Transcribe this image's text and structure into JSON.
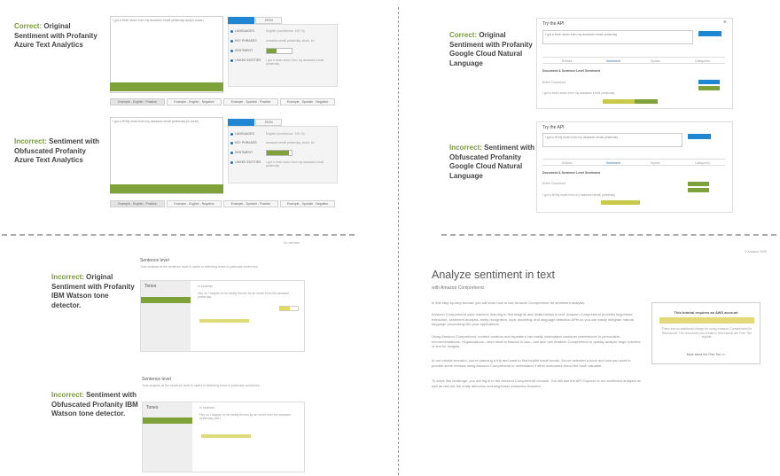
{
  "captions": {
    "top_left": {
      "head": "Correct:",
      "rest": " Original Sentiment with Profanity Azure Text Analytics"
    },
    "mid_left": {
      "head": "Incorrect:",
      "rest": " Sentiment with Obfuscated Profanity Azure Text Analytics"
    },
    "top_right": {
      "head": "Correct:",
      "rest": " Original Sentiment with Profanity Google Cloud Natural Language"
    },
    "mid_right": {
      "head": "Incorrect:",
      "rest": " Sentiment with Obfuscated Profanity Google Cloud Natural Language"
    },
    "bottom_left_1": {
      "head": "Incorrect:",
      "rest": " Original Sentiment with Profanity IBM Watson tone detector."
    },
    "bottom_left_2": {
      "head": "Incorrect:",
      "rest": " Sentiment with Obfuscated Profanity IBM Watson tone detector."
    }
  },
  "azure": {
    "input_text": "I got a fresh slush from my assassin email yesterday and(is curse)",
    "input_text_obf": "I got a f#*kly slush from my assassin email yesterday (is curse)",
    "tab1": "",
    "tab2": "JSON",
    "rows": [
      {
        "label": "LANGUAGES",
        "value": "English (confidence: 100 %)"
      },
      {
        "label": "KEY PHRASES",
        "value": "assassin email yesterday, slush, lol"
      },
      {
        "label": "SENTIMENT",
        "value": ""
      },
      {
        "label": "LINKED ENTITIES",
        "value": "I got a fresh slush from my assassin email yesterday"
      }
    ],
    "examples": [
      "Example - English - Positive",
      "Example - English - Negative",
      "Example - Spanish - Positive",
      "Example - Spanish - Negative"
    ]
  },
  "google": {
    "try_title": "Try the API",
    "close": "×",
    "input_text": "I got a fresh slush from my assassin email yesterday",
    "input_text_obf": "I got a f#*kly slush from my assassin email yesterday",
    "analyze": "ANALYZE",
    "tabs": [
      "Entities",
      "Sentiment",
      "Syntax",
      "Categories"
    ],
    "sections": [
      "Document & Sentence Level Sentiment",
      "Entire Document",
      "Score",
      "Magnitude"
    ]
  },
  "ibm": {
    "heading": "Sentence level",
    "heading2": "Sentence level",
    "tones_label": "Tones",
    "top_right_note": "Do not tone",
    "sentence_tag": "In sadness",
    "desc": "Tone analysis at the sentence level is useful in detecting tones in particular sentences.",
    "sentence_text": "Hey so I happen to be totally thrown by an email from the assassin yesterday",
    "sentence_text_obf": "Hey so I happen to be totally thrown by an email from the assassin yesterday (obf.)"
  },
  "aws": {
    "title": "Analyze sentiment in text",
    "subtitle": "with Amazon Comprehend",
    "p1": "In this step-by-step tutorial, you will learn how to use Amazon Comprehend for sentiment analysis.",
    "p2": "Amazon Comprehend uses machine learning to find insights and relationships in text. Amazon Comprehend provides keyphrase extraction, sentiment analysis, entity recognition, topic modeling, and language detection APIs so you can easily integrate natural language processing into your applications.",
    "p3": "Using Amazon Comprehend, content creators and repeaters can easily understand customer preferences to personalize recommendations. Organizations—from retail to finance to law—can also use Amazon Comprehend to quickly analyze large volumes of text for insights.",
    "p4": "In our tutorial scenario, you're planning a trip and want to find helpful travel books. You've selected a book and now you want to provide some reviews using Amazon Comprehend to understand if other customers found the book valuable.",
    "p5": "To solve this challenge, you will log in to the Amazon Comprehend console. You will use the API Explorer to run sentiment analysis as well as test out the entity detection and keyphrase extraction features.",
    "sidebox_title": "This tutorial requires an AWS account",
    "sidebox_body": "There are no additional charge for using Amazon Comprehend for this tutorial. The resources you create in this tutorial are Free Tier eligible.",
    "sidebox_link": "More about the Free Tier >>",
    "corner_note": "© Amazon 2020"
  }
}
